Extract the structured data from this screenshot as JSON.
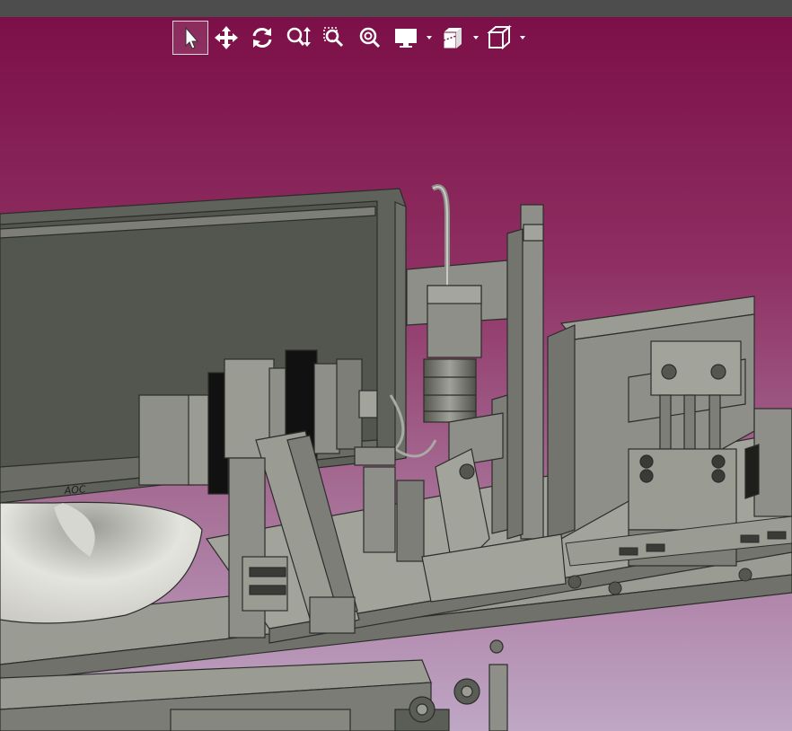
{
  "window": {
    "title": ""
  },
  "viewer": {
    "background_top": "#7c0f47",
    "background_bottom": "#bfa7c6",
    "model_color": "#8d8f88",
    "active_tool": "select"
  },
  "toolbar": {
    "tools": [
      {
        "id": "select",
        "icon": "pointer-icon",
        "active": true
      },
      {
        "id": "pan",
        "icon": "move-arrows-icon",
        "active": false
      },
      {
        "id": "rotate",
        "icon": "rotate-icon",
        "active": false
      },
      {
        "id": "zoom",
        "icon": "zoom-updown-icon",
        "active": false
      },
      {
        "id": "zoom-window",
        "icon": "zoom-window-icon",
        "active": false
      },
      {
        "id": "zoom-fit",
        "icon": "zoom-fit-icon",
        "active": false
      },
      {
        "id": "display-mode",
        "icon": "monitor-icon",
        "dropdown": true
      },
      {
        "id": "section",
        "icon": "section-box-icon",
        "dropdown": true
      },
      {
        "id": "view-orientation",
        "icon": "cube-icon",
        "dropdown": true
      }
    ]
  },
  "model": {
    "monitor_brand_label": "AOC"
  }
}
